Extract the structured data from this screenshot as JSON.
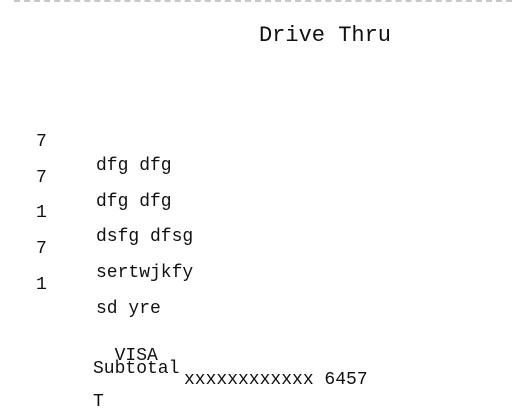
{
  "receipt": {
    "title": "Drive Thru",
    "items": [
      {
        "qty": "7",
        "name": "dfg dfg"
      },
      {
        "qty": "7",
        "name": "dfg dfg"
      },
      {
        "qty": "1",
        "name": "dsfg dfsg"
      },
      {
        "qty": "7",
        "name": "sertwjkfy"
      },
      {
        "qty": "1",
        "name": "sd yre"
      }
    ],
    "payment": {
      "card_type": "VISA",
      "card_number": "xxxxxxxxxxxx 6457"
    },
    "subtotal_label": "Subtotal",
    "next_line_partial": "T"
  }
}
